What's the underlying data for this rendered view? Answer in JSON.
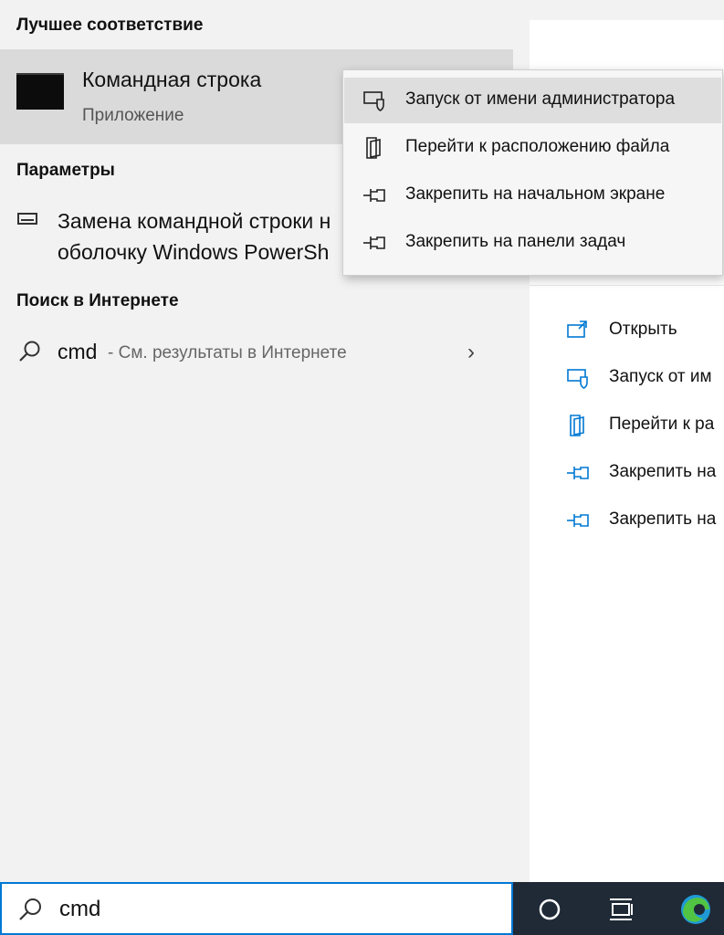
{
  "sections": {
    "best_match_heading": "Лучшее соответствие",
    "settings_heading": "Параметры",
    "web_heading": "Поиск в Интернете"
  },
  "best_match": {
    "title": "Командная строка",
    "subtitle": "Приложение"
  },
  "settings_item": {
    "line1": "Замена командной строки н",
    "line2": "оболочку Windows PowerSh"
  },
  "web_result": {
    "query": "cmd",
    "suffix": "- См. результаты в Интернете"
  },
  "context_menu": [
    {
      "label": "Запуск от имени администратора",
      "icon": "admin-shield-icon"
    },
    {
      "label": "Перейти к расположению файла",
      "icon": "file-location-icon"
    },
    {
      "label": "Закрепить на начальном экране",
      "icon": "pin-icon"
    },
    {
      "label": "Закрепить на панели задач",
      "icon": "pin-icon"
    }
  ],
  "right_actions": [
    {
      "label": "Открыть",
      "icon": "open-icon"
    },
    {
      "label": "Запуск от им",
      "icon": "admin-shield-icon"
    },
    {
      "label": "Перейти к ра",
      "icon": "file-location-icon"
    },
    {
      "label": "Закрепить на",
      "icon": "pin-icon"
    },
    {
      "label": "Закрепить на",
      "icon": "pin-icon"
    }
  ],
  "search_box": {
    "value": "cmd"
  },
  "taskbar": {
    "icons": [
      "cortana-icon",
      "task-view-icon",
      "edge-icon"
    ]
  },
  "colors": {
    "accent": "#0078d4",
    "taskbar": "#1f2a36",
    "selected": "#dadada"
  }
}
